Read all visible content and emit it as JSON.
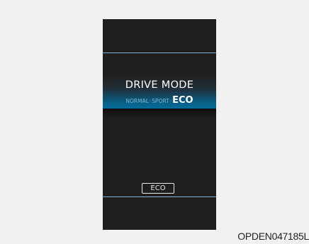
{
  "display": {
    "title": "DRIVE MODE",
    "modes": {
      "normal": "NORMAL",
      "separator_1": "·",
      "sport": "SPORT",
      "separator_2": "·",
      "eco": "ECO"
    },
    "active_mode": "ECO",
    "indicator_label": "ECO"
  },
  "figure_code": "OPDEN047185L",
  "colors": {
    "page_background": "#f1f1f1",
    "display_background": "#211f1e",
    "accent_line": "#7fb4d4",
    "highlight_band": "#0078af",
    "text_primary": "#ffffff",
    "text_inactive": "#79b8d6"
  }
}
